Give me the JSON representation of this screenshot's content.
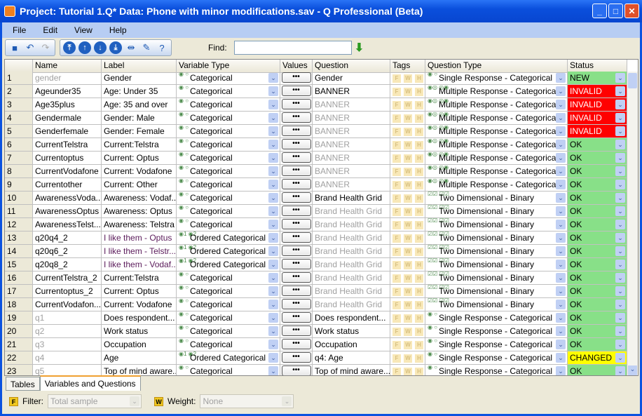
{
  "window": {
    "title": "Project: Tutorial 1.Q*  Data: Phone with minor modifications.sav - Q Professional (Beta)"
  },
  "menu": [
    "File",
    "Edit",
    "View",
    "Help"
  ],
  "toolbar": {
    "find_label": "Find:",
    "find_value": ""
  },
  "columns": [
    "",
    "Name",
    "Label",
    "Variable Type",
    "Values",
    "Question",
    "Tags",
    "Question Type",
    "Status"
  ],
  "colors": {
    "ok": "#88e088",
    "invalid": "#ff0000",
    "changed": "#ffff00",
    "accent": "#0a46d6"
  },
  "rows": [
    [
      "1",
      "gender",
      "Gender",
      "Categorical",
      "Gender",
      "Single Response - Categorical",
      "NEW",
      1,
      0,
      0
    ],
    [
      "2",
      "Ageunder35",
      "Age: Under 35",
      "Categorical",
      "BANNER",
      "Multiple Response - Categorical",
      "INVALID",
      0,
      0,
      0
    ],
    [
      "3",
      "Age35plus",
      "Age: 35 and over",
      "Categorical",
      "BANNER",
      "Multiple Response - Categorical",
      "INVALID",
      0,
      1,
      0
    ],
    [
      "4",
      "Gendermale",
      "Gender: Male",
      "Categorical",
      "BANNER",
      "Multiple Response - Categorical",
      "INVALID",
      0,
      1,
      0
    ],
    [
      "5",
      "Genderfemale",
      "Gender: Female",
      "Categorical",
      "BANNER",
      "Multiple Response - Categorical",
      "INVALID",
      0,
      1,
      0
    ],
    [
      "6",
      "CurrentTelstra",
      "Current:Telstra",
      "Categorical",
      "BANNER",
      "Multiple Response - Categorical",
      "OK",
      0,
      1,
      0
    ],
    [
      "7",
      "Currentoptus",
      "Current: Optus",
      "Categorical",
      "BANNER",
      "Multiple Response - Categorical",
      "OK",
      0,
      1,
      0
    ],
    [
      "8",
      "CurrentVodafone",
      "Current: Vodafone",
      "Categorical",
      "BANNER",
      "Multiple Response - Categorical",
      "OK",
      0,
      1,
      0
    ],
    [
      "9",
      "Currentother",
      "Current: Other",
      "Categorical",
      "BANNER",
      "Multiple Response - Categorical",
      "OK",
      0,
      1,
      0
    ],
    [
      "10",
      "AwarenessVoda...",
      "Awareness:  Vodaf...",
      "Categorical",
      "Brand Health Grid",
      "Two Dimensional - Binary",
      "OK",
      0,
      0,
      0
    ],
    [
      "11",
      "AwarenessOptus",
      "Awareness: Optus",
      "Categorical",
      "Brand Health Grid",
      "Two Dimensional - Binary",
      "OK",
      0,
      1,
      0
    ],
    [
      "12",
      "AwarenessTelst...",
      "Awareness: Telstra",
      "Categorical",
      "Brand Health Grid",
      "Two Dimensional - Binary",
      "OK",
      0,
      1,
      0
    ],
    [
      "13",
      "q20q4_2",
      "I like them - Optus",
      "Ordered Categorical",
      "Brand Health Grid",
      "Two Dimensional - Binary",
      "OK",
      0,
      1,
      1
    ],
    [
      "14",
      "q20q6_2",
      "I like them - Telstr...",
      "Ordered Categorical",
      "Brand Health Grid",
      "Two Dimensional - Binary",
      "OK",
      0,
      1,
      1
    ],
    [
      "15",
      "q20q8_2",
      "I like them - Vodaf...",
      "Ordered Categorical",
      "Brand Health Grid",
      "Two Dimensional - Binary",
      "OK",
      0,
      1,
      1
    ],
    [
      "16",
      "CurrentTelstra_2",
      "Current:Telstra",
      "Categorical",
      "Brand Health Grid",
      "Two Dimensional - Binary",
      "OK",
      0,
      1,
      0
    ],
    [
      "17",
      "Currentoptus_2",
      "Current: Optus",
      "Categorical",
      "Brand Health Grid",
      "Two Dimensional - Binary",
      "OK",
      0,
      1,
      0
    ],
    [
      "18",
      "CurrentVodafon...",
      "Current: Vodafone",
      "Categorical",
      "Brand Health Grid",
      "Two Dimensional - Binary",
      "OK",
      0,
      1,
      0
    ],
    [
      "19",
      "q1",
      "Does  respondent...",
      "Categorical",
      "Does  respondent...",
      "Single Response - Categorical",
      "OK",
      1,
      0,
      0
    ],
    [
      "20",
      "q2",
      "Work status",
      "Categorical",
      "Work status",
      "Single Response - Categorical",
      "OK",
      1,
      0,
      0
    ],
    [
      "21",
      "q3",
      "Occupation",
      "Categorical",
      "Occupation",
      "Single Response - Categorical",
      "OK",
      1,
      0,
      0
    ],
    [
      "22",
      "q4",
      "Age",
      "Ordered Categorical",
      "q4: Age",
      "Single Response - Categorical",
      "CHANGED",
      1,
      0,
      0
    ],
    [
      "23",
      "q5",
      "Top of mind aware...",
      "Categorical",
      "Top of mind aware...",
      "Single Response - Categorical",
      "OK",
      1,
      0,
      0
    ]
  ],
  "values_button": "•••",
  "tags": [
    "F",
    "W",
    "H"
  ],
  "tabs": [
    "Tables",
    "Variables and Questions"
  ],
  "filter": {
    "label": "Filter:",
    "value": "Total sample",
    "icon": "F"
  },
  "weight": {
    "label": "Weight:",
    "value": "None",
    "icon": "W"
  }
}
